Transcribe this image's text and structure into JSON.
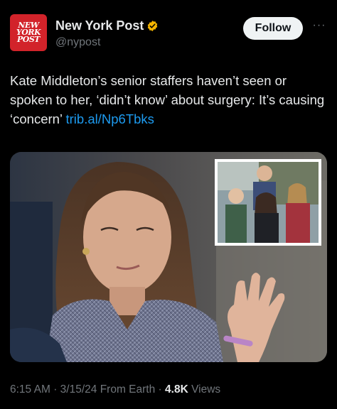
{
  "account": {
    "display_name": "New York Post",
    "handle": "@nypost",
    "avatar_lines": [
      "NEW",
      "YORK",
      "POST"
    ],
    "verified": true,
    "verified_color": "#f4b400"
  },
  "actions": {
    "follow_label": "Follow",
    "more_label": "···"
  },
  "tweet": {
    "text": "Kate Middleton’s senior staffers haven’t seen or spoken to her, ‘didn’t know’ about surgery: It’s causing ‘concern’ ",
    "link_text": "trib.al/Np6Tbks"
  },
  "media": {
    "type": "photo",
    "inset_photo": true
  },
  "meta": {
    "time": "6:15 AM",
    "date": "3/15/24",
    "source": "From Earth",
    "views_count": "4.8K",
    "views_label": "Views",
    "separator": "·"
  },
  "colors": {
    "background": "#000000",
    "link": "#1d9bf0",
    "secondary_text": "#71767b",
    "brand_red": "#d2232a"
  }
}
